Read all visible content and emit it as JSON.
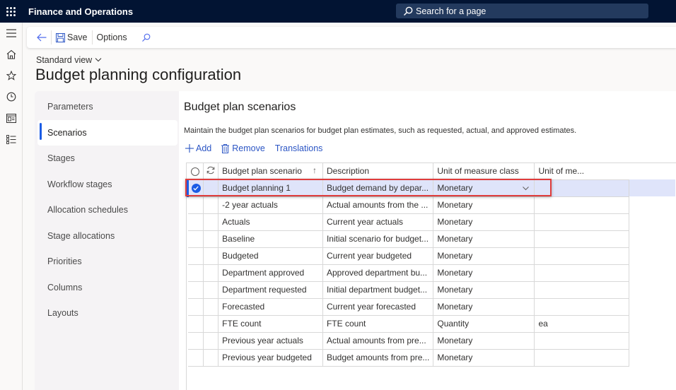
{
  "app": {
    "title": "Finance and Operations"
  },
  "search": {
    "placeholder": "Search for a page"
  },
  "rail": {
    "icons": [
      "hamburger-icon",
      "home-icon",
      "star-icon",
      "clock-icon",
      "workspace-icon",
      "list-icon"
    ]
  },
  "actionpane": {
    "save_label": "Save",
    "options_label": "Options"
  },
  "header": {
    "view": "Standard view",
    "title": "Budget planning configuration"
  },
  "tabs": [
    {
      "label": "Parameters",
      "active": false
    },
    {
      "label": "Scenarios",
      "active": true
    },
    {
      "label": "Stages",
      "active": false
    },
    {
      "label": "Workflow stages",
      "active": false
    },
    {
      "label": "Allocation schedules",
      "active": false
    },
    {
      "label": "Stage allocations",
      "active": false
    },
    {
      "label": "Priorities",
      "active": false
    },
    {
      "label": "Columns",
      "active": false
    },
    {
      "label": "Layouts",
      "active": false
    }
  ],
  "section": {
    "title": "Budget plan scenarios",
    "description": "Maintain the budget plan scenarios for budget plan estimates, such as requested, actual, and approved estimates."
  },
  "grid_toolbar": {
    "add": "Add",
    "remove": "Remove",
    "translations": "Translations"
  },
  "grid": {
    "columns": [
      "Budget plan scenario",
      "Description",
      "Unit of measure class",
      "Unit of me..."
    ],
    "rows": [
      {
        "scenario": "Budget planning 1",
        "description": "Budget demand by depar...",
        "uom_class": "Monetary",
        "unit": "",
        "selected": true
      },
      {
        "scenario": "-2 year actuals",
        "description": "Actual amounts from the ...",
        "uom_class": "Monetary",
        "unit": ""
      },
      {
        "scenario": "Actuals",
        "description": "Current year actuals",
        "uom_class": "Monetary",
        "unit": ""
      },
      {
        "scenario": "Baseline",
        "description": "Initial scenario for budget...",
        "uom_class": "Monetary",
        "unit": ""
      },
      {
        "scenario": "Budgeted",
        "description": "Current year budgeted",
        "uom_class": "Monetary",
        "unit": ""
      },
      {
        "scenario": "Department approved",
        "description": "Approved department bu...",
        "uom_class": "Monetary",
        "unit": ""
      },
      {
        "scenario": "Department requested",
        "description": "Initial department budget...",
        "uom_class": "Monetary",
        "unit": ""
      },
      {
        "scenario": "Forecasted",
        "description": "Current year forecasted",
        "uom_class": "Monetary",
        "unit": ""
      },
      {
        "scenario": "FTE count",
        "description": "FTE count",
        "uom_class": "Quantity",
        "unit": "ea"
      },
      {
        "scenario": "Previous year actuals",
        "description": "Actual amounts from pre...",
        "uom_class": "Monetary",
        "unit": ""
      },
      {
        "scenario": "Previous year budgeted",
        "description": "Budget amounts from pre...",
        "uom_class": "Monetary",
        "unit": ""
      }
    ]
  },
  "colors": {
    "topbar": "#021433",
    "accent": "#1b5ce5",
    "link": "#2b55c4",
    "highlight": "#e03c3c",
    "selected_row": "#dfe4fa"
  }
}
